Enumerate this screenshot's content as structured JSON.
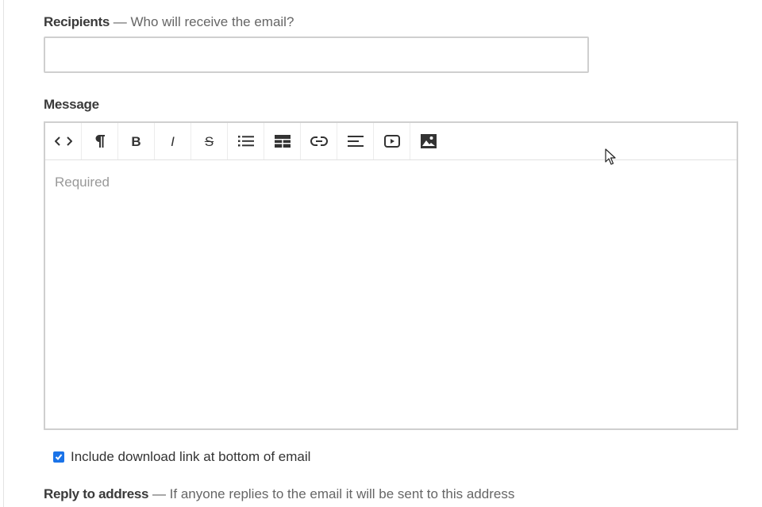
{
  "recipients": {
    "label": "Recipients",
    "hint": "— Who will receive the email?",
    "value": "",
    "placeholder": ""
  },
  "message": {
    "label": "Message",
    "placeholder": "Required",
    "toolbar": {
      "tools": [
        {
          "name": "code-view",
          "icon": "code-icon"
        },
        {
          "name": "paragraph",
          "icon": "pilcrow-icon"
        },
        {
          "name": "bold",
          "icon": "bold-icon",
          "text": "B"
        },
        {
          "name": "italic",
          "icon": "italic-icon",
          "text": "I"
        },
        {
          "name": "strikethrough",
          "icon": "strikethrough-icon",
          "text": "S"
        },
        {
          "name": "list",
          "icon": "list-icon"
        },
        {
          "name": "table",
          "icon": "table-icon"
        },
        {
          "name": "link",
          "icon": "link-icon"
        },
        {
          "name": "align",
          "icon": "align-left-icon"
        },
        {
          "name": "video",
          "icon": "video-icon"
        },
        {
          "name": "image",
          "icon": "image-icon"
        }
      ]
    }
  },
  "download_link": {
    "label": "Include download link at bottom of email",
    "checked": true
  },
  "reply_to": {
    "label": "Reply to address",
    "hint": "— If anyone replies to the email it will be sent to this address"
  },
  "colors": {
    "checkbox_accent": "#1a73e8",
    "border": "#cfcfcf",
    "placeholder": "#999999"
  }
}
